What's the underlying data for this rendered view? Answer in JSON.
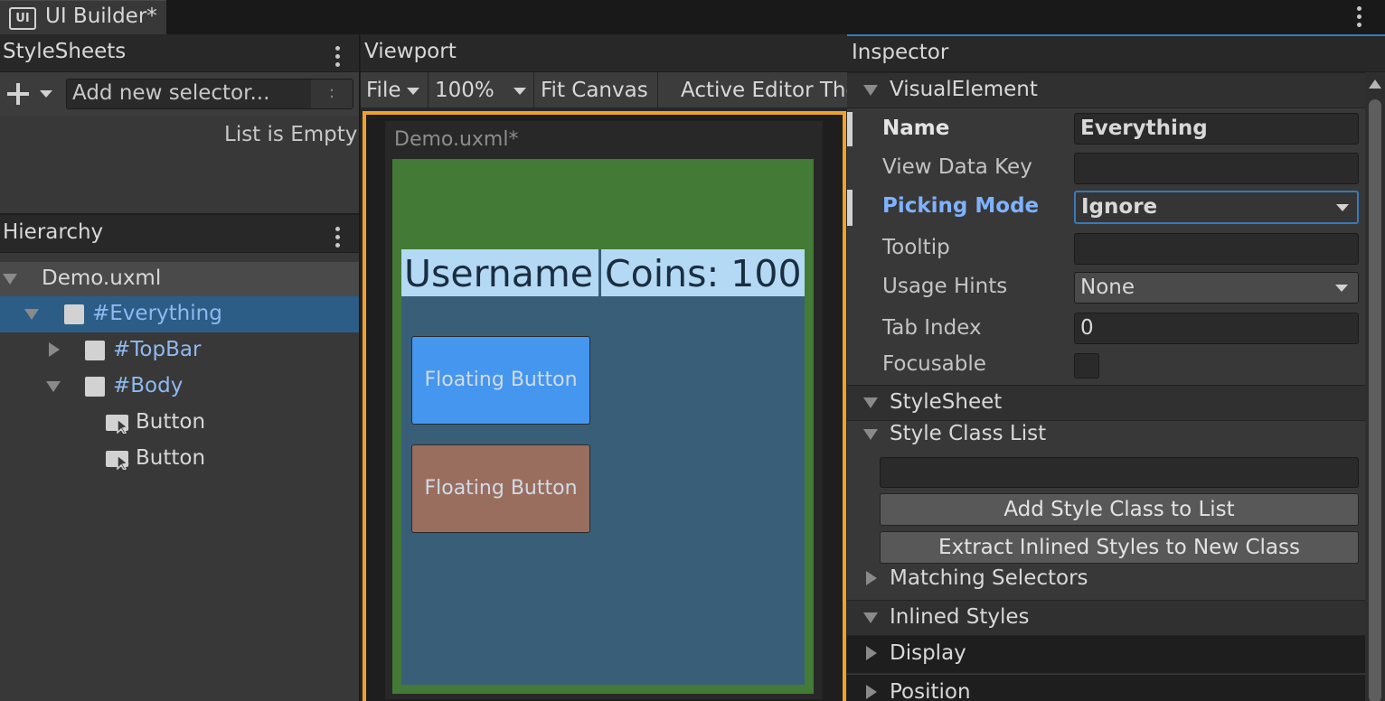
{
  "window": {
    "tab_title": "UI Builder*",
    "tab_icon_text": "UI"
  },
  "stylesheets": {
    "title": "StyleSheets",
    "selector_placeholder": "Add new selector...",
    "selector_suffix": ":",
    "empty_text": "List is Empty"
  },
  "hierarchy": {
    "title": "Hierarchy",
    "root": "Demo.uxml",
    "items": [
      {
        "label": "#Everything"
      },
      {
        "label": "#TopBar"
      },
      {
        "label": "#Body"
      },
      {
        "label": "Button"
      },
      {
        "label": "Button"
      }
    ]
  },
  "viewport": {
    "title": "Viewport",
    "toolbar": {
      "file": "File",
      "zoom": "100%",
      "fit": "Fit Canvas",
      "theme": "Active Editor Theme"
    },
    "doc_label": "Demo.uxml*",
    "topbar": {
      "username": "Username",
      "coins": "Coins: 100"
    },
    "buttons": [
      {
        "label": "Floating Button",
        "color": "#4596ee"
      },
      {
        "label": "Floating Button",
        "color": "#9a6e5e"
      }
    ]
  },
  "inspector": {
    "title": "Inspector",
    "visual_element": "VisualElement",
    "fields": {
      "name_label": "Name",
      "name_value": "Everything",
      "view_data_key_label": "View Data Key",
      "view_data_key_value": "",
      "picking_mode_label": "Picking Mode",
      "picking_mode_value": "Ignore",
      "tooltip_label": "Tooltip",
      "tooltip_value": "",
      "usage_hints_label": "Usage Hints",
      "usage_hints_value": "None",
      "tab_index_label": "Tab Index",
      "tab_index_value": "0",
      "focusable_label": "Focusable"
    },
    "stylesheet_section": "StyleSheet",
    "style_class_list": "Style Class List",
    "add_style_class": "Add Style Class to List",
    "extract_inlined": "Extract Inlined Styles to New Class",
    "matching_selectors": "Matching Selectors",
    "inlined_styles": "Inlined Styles",
    "display": "Display",
    "position": "Position"
  },
  "colors": {
    "accent_blue": "#3a79bb",
    "selection": "#2c5d87",
    "frame_orange": "#f0a12b",
    "picking_label": "#7fb2ff"
  }
}
